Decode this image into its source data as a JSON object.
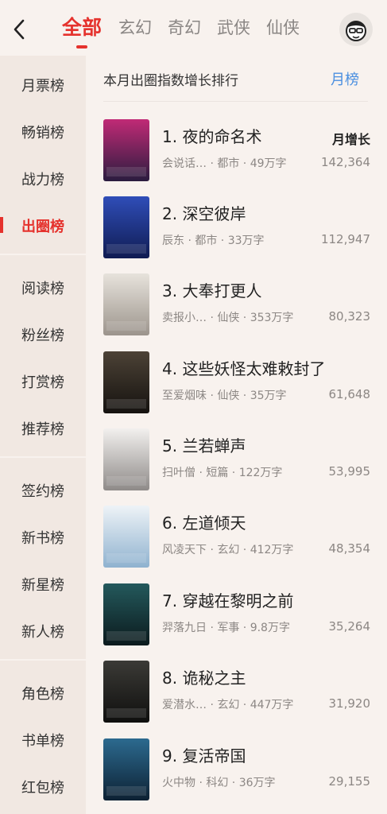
{
  "header": {
    "tabs": [
      "全部",
      "玄幻",
      "奇幻",
      "武侠",
      "仙侠"
    ]
  },
  "sidebar": {
    "groups": [
      [
        "月票榜",
        "畅销榜",
        "战力榜",
        "出圈榜"
      ],
      [
        "阅读榜",
        "粉丝榜",
        "打赏榜",
        "推荐榜"
      ],
      [
        "签约榜",
        "新书榜",
        "新星榜",
        "新人榜"
      ],
      [
        "角色榜",
        "书单榜",
        "红包榜"
      ]
    ],
    "active": "出圈榜"
  },
  "list": {
    "title": "本月出圈指数增长排行",
    "period": "月榜",
    "growth_label": "月增长",
    "books": [
      {
        "title": "1. 夜的命名术",
        "meta": "会说话… · 都市 · 49万字",
        "value": "142,364",
        "cover_colors": [
          "#c12a76",
          "#2a1c3f"
        ]
      },
      {
        "title": "2. 深空彼岸",
        "meta": "辰东 · 都市 · 33万字",
        "value": "112,947",
        "cover_colors": [
          "#2f4db8",
          "#101c52"
        ]
      },
      {
        "title": "3. 大奉打更人",
        "meta": "卖报小… · 仙侠 · 353万字",
        "value": "80,323",
        "cover_colors": [
          "#e7e3dc",
          "#9c948c"
        ]
      },
      {
        "title": "4. 这些妖怪太难敕封了",
        "meta": "至爱烟味 · 仙侠 · 35万字",
        "value": "61,648",
        "cover_colors": [
          "#4c4236",
          "#15120f"
        ]
      },
      {
        "title": "5. 兰若蝉声",
        "meta": "扫叶僧 · 短篇 · 122万字",
        "value": "53,995",
        "cover_colors": [
          "#f2f0ee",
          "#8e8a88"
        ]
      },
      {
        "title": "6. 左道倾天",
        "meta": "风凌天下 · 玄幻 · 412万字",
        "value": "48,354",
        "cover_colors": [
          "#eef3f7",
          "#8fb2cf"
        ]
      },
      {
        "title": "7. 穿越在黎明之前",
        "meta": "羿落九日 · 军事 · 9.8万字",
        "value": "35,264",
        "cover_colors": [
          "#24595c",
          "#0b1a1d"
        ]
      },
      {
        "title": "8. 诡秘之主",
        "meta": "爱潜水… · 玄幻 · 447万字",
        "value": "31,920",
        "cover_colors": [
          "#3b3a36",
          "#0f0f0e"
        ]
      },
      {
        "title": "9. 复活帝国",
        "meta": "火中物 · 科幻 · 36万字",
        "value": "29,155",
        "cover_colors": [
          "#2c6a8f",
          "#0d2133"
        ]
      }
    ]
  }
}
